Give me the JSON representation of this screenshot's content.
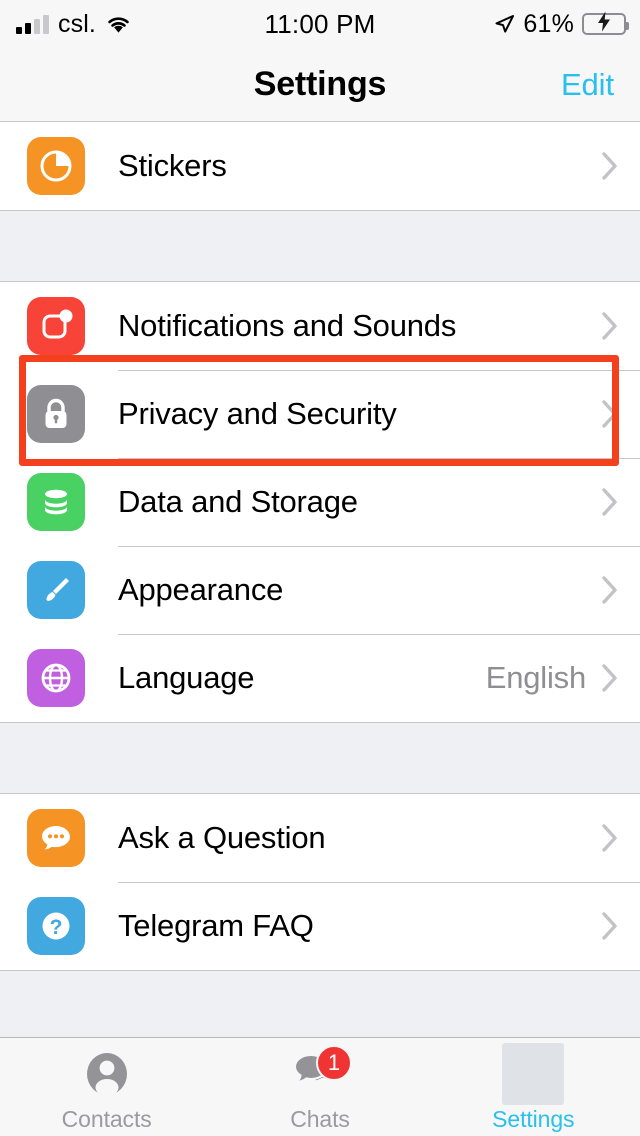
{
  "status_bar": {
    "carrier": "csl.",
    "time": "11:00 PM",
    "battery_percent": "61%",
    "battery_level": 61,
    "signal_bars_filled": 2,
    "signal_bars_total": 4,
    "wifi_icon": "wifi-icon",
    "location_icon": "location-arrow-icon",
    "battery_icon": "battery-charging-icon"
  },
  "nav": {
    "title": "Settings",
    "edit_label": "Edit"
  },
  "colors": {
    "accent": "#29c0ec",
    "highlight": "#f4401c",
    "separator": "#c8c7cc",
    "group_background": "#eff0f4",
    "value_text": "#8e8e93",
    "badge": "#f03434",
    "stickers_icon": "#f59324",
    "notifications_icon": "#f74338",
    "privacy_icon": "#8e8e93",
    "data_icon": "#4ad164",
    "appearance_icon": "#41a8e0",
    "language_icon": "#c060e0",
    "ask_icon": "#f59324",
    "faq_icon": "#41a8e0"
  },
  "sections": [
    {
      "name": "stickers-section",
      "rows": [
        {
          "label": "Stickers",
          "icon": "stickers-icon",
          "value": "",
          "chevron": "chevron-right-icon"
        }
      ]
    },
    {
      "name": "preferences-section",
      "rows": [
        {
          "label": "Notifications and Sounds",
          "icon": "notifications-icon",
          "value": "",
          "chevron": "chevron-right-icon"
        },
        {
          "label": "Privacy and Security",
          "icon": "lock-icon",
          "value": "",
          "chevron": "chevron-right-icon"
        },
        {
          "label": "Data and Storage",
          "icon": "database-icon",
          "value": "",
          "chevron": "chevron-right-icon"
        },
        {
          "label": "Appearance",
          "icon": "paintbrush-icon",
          "value": "",
          "chevron": "chevron-right-icon"
        },
        {
          "label": "Language",
          "icon": "globe-icon",
          "value": "English",
          "chevron": "chevron-right-icon"
        }
      ]
    },
    {
      "name": "help-section",
      "rows": [
        {
          "label": "Ask a Question",
          "icon": "chat-bubble-icon",
          "value": "",
          "chevron": "chevron-right-icon"
        },
        {
          "label": "Telegram FAQ",
          "icon": "question-mark-icon",
          "value": "",
          "chevron": "chevron-right-icon"
        }
      ]
    }
  ],
  "highlight": {
    "target_row": "Privacy and Security",
    "shape": "rectangle"
  },
  "tabs": [
    {
      "label": "Contacts",
      "icon": "person-icon",
      "active": false,
      "badge": ""
    },
    {
      "label": "Chats",
      "icon": "chats-icon",
      "active": false,
      "badge": "1"
    },
    {
      "label": "Settings",
      "icon": "settings-icon",
      "active": true,
      "badge": ""
    }
  ]
}
